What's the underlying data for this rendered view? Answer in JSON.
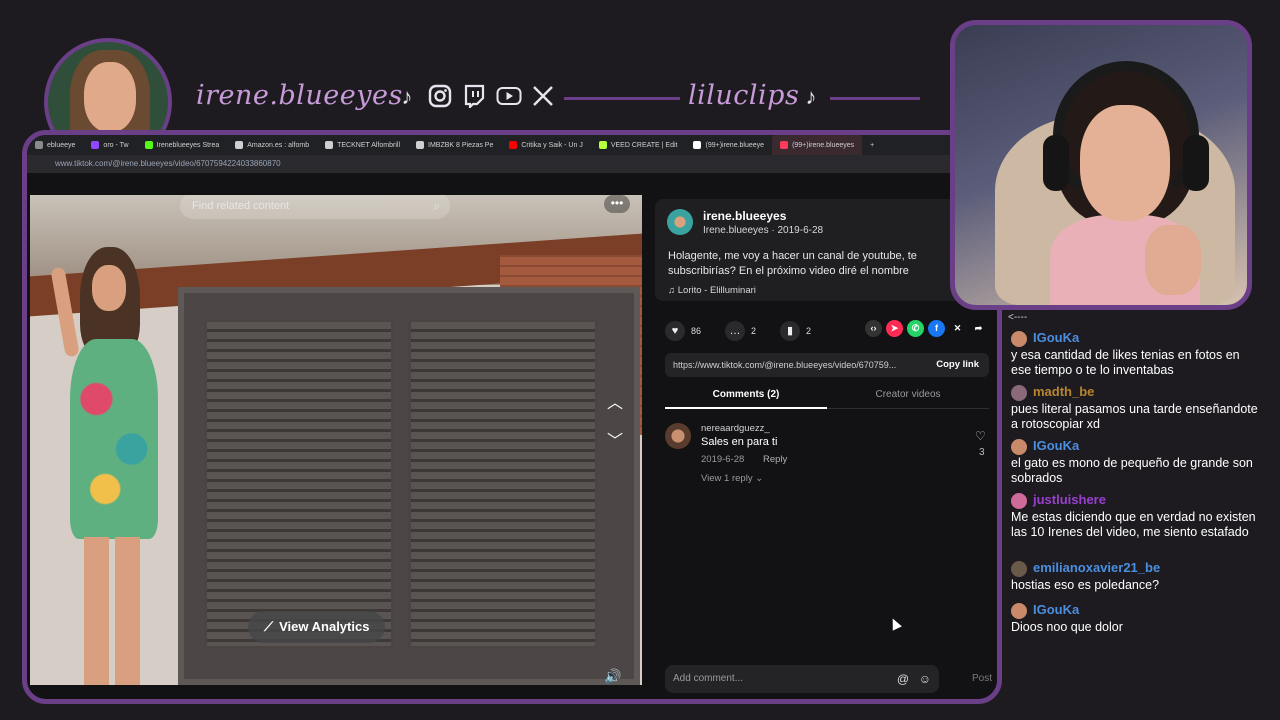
{
  "overlay": {
    "streamer_handle": "irene.blueeyes",
    "clips_handle": "liluclips",
    "social_icons": [
      "tiktok-icon",
      "instagram-icon",
      "twitch-icon",
      "youtube-icon",
      "x-icon"
    ]
  },
  "browser": {
    "tabs": [
      {
        "label": "eblueeye",
        "color": "#8a8a8a"
      },
      {
        "label": "oro - Tw",
        "color": "#9146ff"
      },
      {
        "label": "Ireneblueeyes Strea",
        "color": "#53fc18"
      },
      {
        "label": "Amazon.es : alfomb",
        "color": "#cfcfcf"
      },
      {
        "label": "TECKNET Alfombrill",
        "color": "#cfcfcf"
      },
      {
        "label": "IMBZBK 8 Piezas Pe",
        "color": "#cfcfcf"
      },
      {
        "label": "Critika y Saik - Un J",
        "color": "#ff0000"
      },
      {
        "label": "VEED CREATE | Edit",
        "color": "#b6ff3b"
      },
      {
        "label": "(99+)irene.blueeye",
        "color": "#ffffff"
      },
      {
        "label": "(99+)irene.blueeyes",
        "color": "#ff3b5c"
      }
    ],
    "url": "www.tiktok.com/@irene.blueeyes/video/6707594224033860870"
  },
  "video": {
    "search_placeholder": "Find related content",
    "view_analytics": "View Analytics"
  },
  "post": {
    "author": "irene.blueeyes",
    "author_sub": "Irene.blueeyes · 2019-6-28",
    "caption": "Holagente, me voy a hacer un canal de youtube, te subscribirías? En el próximo video diré el nombre",
    "music": "Lorito - Elilluminari",
    "likes": "86",
    "comments_count": "2",
    "saves": "2",
    "link": "https://www.tiktok.com/@irene.blueeyes/video/670759...",
    "copy_link": "Copy link",
    "tab_comments": "Comments (2)",
    "tab_creator": "Creator videos",
    "comment": {
      "user": "nereaardguezz_",
      "text": "Sales en para ti",
      "date": "2019-6-28",
      "reply": "Reply",
      "view_replies": "View 1 reply",
      "likes": "3"
    },
    "add_comment_placeholder": "Add comment...",
    "post_label": "Post"
  },
  "chat": {
    "top_fragment": "<----",
    "messages": [
      {
        "user": "IGouKa",
        "color": "#4a8fe0",
        "badge": "#c98a6a",
        "text": "y esa cantidad de likes tenias en fotos en ese tiempo o te lo inventabas"
      },
      {
        "user": "madth_be",
        "color": "#b7862e",
        "badge": "#8a6a7a",
        "text": "pues literal pasamos una tarde enseñandote a rotoscopiar xd"
      },
      {
        "user": "IGouKa",
        "color": "#4a8fe0",
        "badge": "#c98a6a",
        "text": "el gato es mono de pequeño de grande son sobrados"
      },
      {
        "user": "justluishere",
        "color": "#9a3fd0",
        "badge": "#d06a9a",
        "text": "Me estas diciendo que en verdad no existen las 10 Irenes del video, me siento estafado"
      },
      {
        "user": "emilianoxavier21_be",
        "color": "#4a8fe0",
        "badge": "#6a5a4a",
        "text": "hostias eso es poledance?"
      },
      {
        "user": "IGouKa",
        "color": "#4a8fe0",
        "badge": "#c98a6a",
        "text": "Dioos noo que dolor"
      }
    ]
  }
}
